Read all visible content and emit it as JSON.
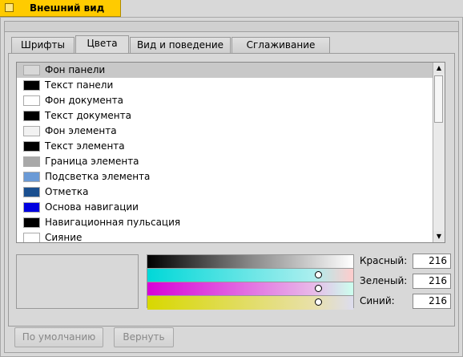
{
  "window": {
    "title": "Внешний вид"
  },
  "tabs": [
    {
      "label": "Шрифты",
      "active": false
    },
    {
      "label": "Цвета",
      "active": true
    },
    {
      "label": "Вид и поведение",
      "active": false
    },
    {
      "label": "Сглаживание",
      "active": false
    }
  ],
  "color_list": {
    "items": [
      {
        "label": "Фон панели",
        "color": "#d8d8d8",
        "selected": true
      },
      {
        "label": "Текст панели",
        "color": "#000000"
      },
      {
        "label": "Фон документа",
        "color": "#ffffff"
      },
      {
        "label": "Текст документа",
        "color": "#000000"
      },
      {
        "label": "Фон элемента",
        "color": "#f2f2f2"
      },
      {
        "label": "Текст элемента",
        "color": "#000000"
      },
      {
        "label": "Граница элемента",
        "color": "#a8a8a8"
      },
      {
        "label": "Подсветка элемента",
        "color": "#6a9ad6"
      },
      {
        "label": "Отметка",
        "color": "#1a4f8f"
      },
      {
        "label": "Основа навигации",
        "color": "#0000e0"
      },
      {
        "label": "Навигационная пульсация",
        "color": "#000000"
      },
      {
        "label": "Сияние",
        "color": "#ffffff"
      }
    ]
  },
  "rgb": {
    "red_label": "Красный:",
    "red_value": "216",
    "green_label": "Зеленый:",
    "green_value": "216",
    "blue_label": "Синий:",
    "blue_value": "216"
  },
  "buttons": {
    "defaults_label": "По умолчанию",
    "revert_label": "Вернуть"
  },
  "colors": {
    "title_tab": "#ffcb00",
    "selection": "#c8c8c8"
  }
}
